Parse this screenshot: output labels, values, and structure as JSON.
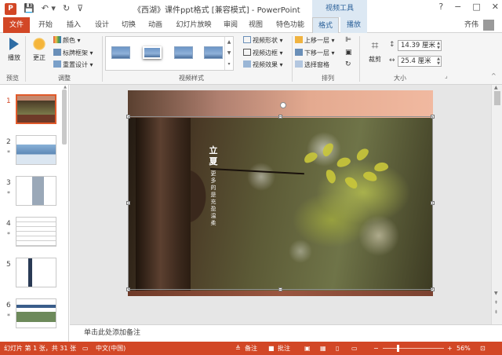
{
  "window": {
    "title": "《西湖》课件ppt格式 [兼容模式] - PowerPoint",
    "contextual_group": "视频工具",
    "controls": [
      "?",
      "−",
      "□",
      "✕"
    ],
    "quick_access": [
      "save",
      "undo",
      "redo",
      "customize"
    ]
  },
  "tabs": [
    {
      "label": "文件"
    },
    {
      "label": "开始"
    },
    {
      "label": "插入"
    },
    {
      "label": "设计"
    },
    {
      "label": "切换"
    },
    {
      "label": "动画"
    },
    {
      "label": "幻灯片放映"
    },
    {
      "label": "审阅"
    },
    {
      "label": "视图"
    },
    {
      "label": "特色功能"
    },
    {
      "label": "格式"
    },
    {
      "label": "播放"
    }
  ],
  "user": {
    "name": "齐伟"
  },
  "ribbon": {
    "preview": {
      "button": "播放",
      "group_label": "预览"
    },
    "adjust": {
      "correct_button": "更正",
      "color_button": "颜色",
      "poster_frame_button": "标牌框架",
      "reset_design_button": "重置设计",
      "group_label": "调整"
    },
    "video_styles": {
      "group_label": "视频样式",
      "shape_button": "视频形状",
      "border_button": "视频边框",
      "effects_button": "视频效果"
    },
    "arrange": {
      "bring_forward": "上移一层",
      "send_backward": "下移一层",
      "selection_pane": "选择窗格",
      "group_label": "排列"
    },
    "size": {
      "crop_button": "裁剪",
      "height": "14.39 厘米",
      "width": "25.4 厘米",
      "group_label": "大小"
    }
  },
  "slides": [
    {
      "num": "1",
      "star": ""
    },
    {
      "num": "2",
      "star": "*"
    },
    {
      "num": "3",
      "star": "*"
    },
    {
      "num": "4",
      "star": "*"
    },
    {
      "num": "5",
      "star": ""
    },
    {
      "num": "6",
      "star": "*"
    }
  ],
  "slide": {
    "title": "立夏",
    "subtitle": "更 多 的 是 充 盈 温 柔"
  },
  "notes": {
    "placeholder": "单击此处添加备注"
  },
  "status": {
    "slide_info": "幻灯片 第 1 张，共 31 张",
    "language": "中文(中国)",
    "notes_button": "备注",
    "comments_button": "批注",
    "zoom": "56%"
  }
}
